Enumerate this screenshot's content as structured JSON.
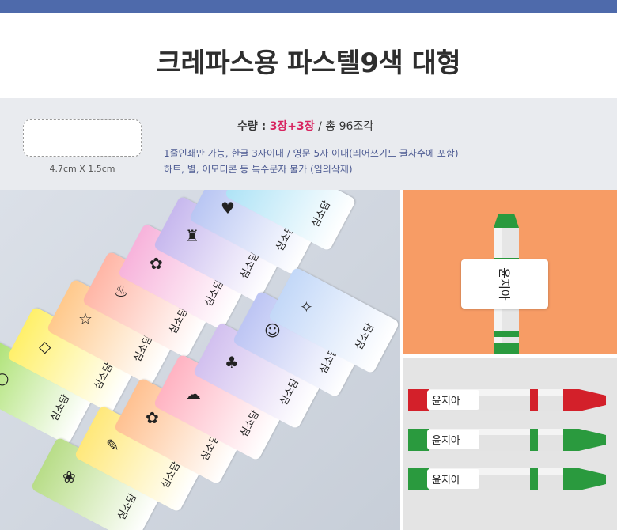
{
  "title": "크레파스용 파스텔9색 대형",
  "info": {
    "size": "4.7cm X 1.5cm",
    "qty_label": "수량 :",
    "qty_value": "3장+3장",
    "qty_sep": "/",
    "qty_total": "총 96조각",
    "note1": "1줄인쇄만 가능, 한글 3자이내 / 영문 5자 이내(띄어쓰기도 글자수에 포함)",
    "note2": "하트, 별, 이모티콘 등 특수문자 불가 (임의삭제)"
  },
  "stickers": {
    "text": "심소담",
    "colors": [
      "#a8e06b",
      "#fff06a",
      "#ffc98c",
      "#ffb6a6",
      "#f7b3db",
      "#c7b8ee",
      "#b9c6f3",
      "#aee3f6",
      "#b8dd88",
      "#ffe87a",
      "#ffc191",
      "#ffb3c2",
      "#d2c0ef",
      "#bdc5f4",
      "#c3d8f8"
    ]
  },
  "crayons": {
    "name": "윤지아",
    "green": "#2a9a3e",
    "red": "#d3202a"
  }
}
